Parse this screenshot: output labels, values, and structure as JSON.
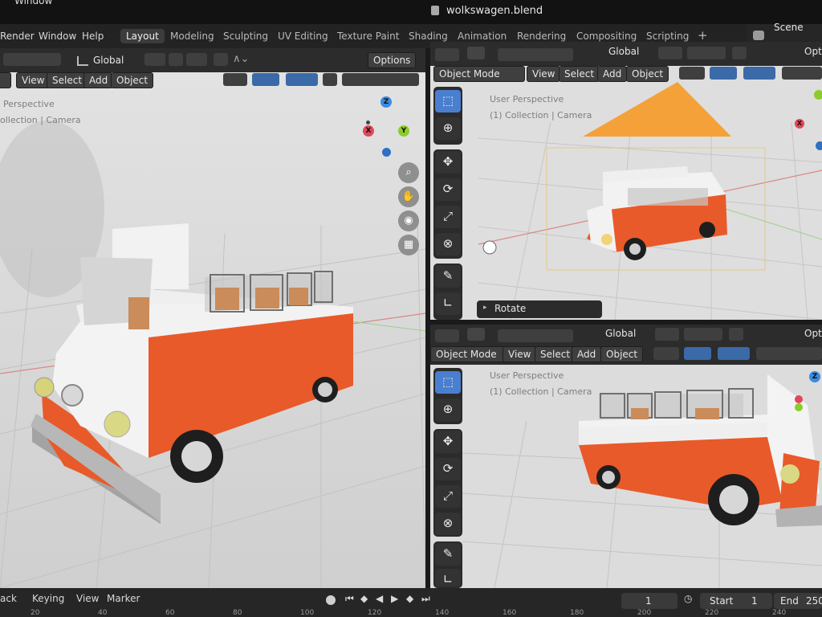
{
  "window": {
    "title": "Window",
    "file_name": "wolkswagen.blend",
    "scene_label": "Scene"
  },
  "menu": {
    "items": [
      "Render",
      "Window",
      "Help"
    ]
  },
  "workspace_tabs": [
    {
      "label": "Layout",
      "active": true
    },
    {
      "label": "Modeling",
      "active": false
    },
    {
      "label": "Sculpting",
      "active": false
    },
    {
      "label": "UV Editing",
      "active": false
    },
    {
      "label": "Texture Paint",
      "active": false
    },
    {
      "label": "Shading",
      "active": false
    },
    {
      "label": "Animation",
      "active": false
    },
    {
      "label": "Rendering",
      "active": false
    },
    {
      "label": "Compositing",
      "active": false
    },
    {
      "label": "Scripting",
      "active": false
    }
  ],
  "add_workspace_symbol": "+",
  "viewports": {
    "left": {
      "orientation": "Global",
      "options_label": "Options",
      "menu": [
        "View",
        "Select",
        "Add",
        "Object"
      ],
      "overlay_line1": "Perspective",
      "overlay_line2": "ollection | Camera",
      "gizmo": {
        "z": "Z",
        "x": "X",
        "y": "Y"
      }
    },
    "top_right": {
      "orientation": "Global",
      "mode": "Object Mode",
      "menu": [
        "View",
        "Select",
        "Add",
        "Object"
      ],
      "overlay_line1": "User Perspective",
      "overlay_line2": "(1) Collection | Camera",
      "operator_panel": "Rotate",
      "options_label": "Opti"
    },
    "bottom_right": {
      "orientation": "Global",
      "mode": "Object Mode",
      "menu": [
        "View",
        "Select",
        "Add",
        "Object"
      ],
      "overlay_line1": "User Perspective",
      "overlay_line2": "(1) Collection | Camera",
      "options_label": "Opti",
      "gizmo_z": "Z"
    }
  },
  "timeline": {
    "menu": [
      "ack",
      "Keying",
      "View",
      "Marker"
    ],
    "current_frame": "1",
    "start_label": "Start",
    "start_value": "1",
    "end_label": "End",
    "end_value": "250",
    "ruler": [
      "20",
      "40",
      "60",
      "80",
      "100",
      "120",
      "140",
      "160",
      "180",
      "200",
      "220",
      "240"
    ]
  },
  "colors": {
    "bus_orange": "#e85a2a",
    "bus_white": "#f2f2f2",
    "camera_orange": "#f5a13a",
    "accent_blue": "#4a7fd0"
  }
}
